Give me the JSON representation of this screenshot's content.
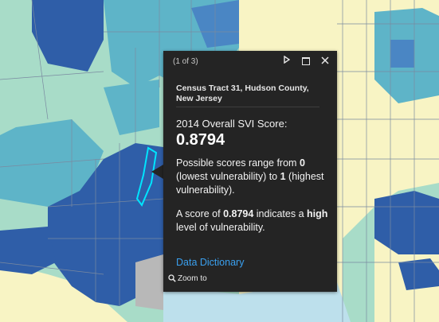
{
  "popup": {
    "pager": "(1 of 3)",
    "title": "Census Tract 31, Hudson County, New Jersey",
    "score_label": "2014 Overall SVI Score:",
    "score_value": "0.8794",
    "range": {
      "t1": "Possible scores range from ",
      "low_value": "0",
      "t2": " (lowest vulnerability) to ",
      "high_value": "1",
      "t3": " (highest vulnerability)."
    },
    "description": {
      "t1": "A score of ",
      "score": "0.8794",
      "t2": " indicates a ",
      "level": "high",
      "t3": " level of vulnerability."
    },
    "link": "Data Dictionary",
    "zoom_label": "Zoom to",
    "icons": {
      "next": "next-arrow-icon",
      "dock": "dock-icon",
      "close": "close-icon",
      "zoom": "magnifier-icon"
    }
  },
  "map": {
    "colors": {
      "very_high": "#2f5ea8",
      "high": "#4a86c4",
      "medium": "#5eb4c8",
      "low": "#a8dcc8",
      "very_low": "#f8f4c4",
      "water": "#bde0ec",
      "park": "#b8b8b8",
      "boundary": "#7a8aa0",
      "selected": "#00e5ff"
    }
  }
}
